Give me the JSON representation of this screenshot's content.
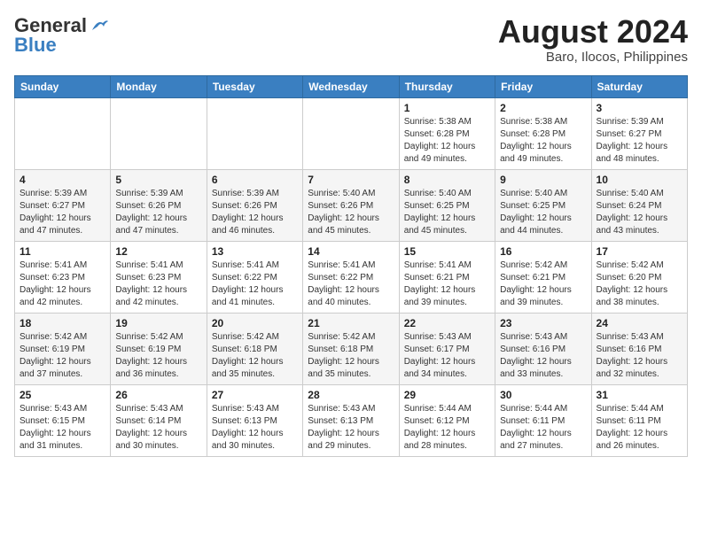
{
  "header": {
    "logo_general": "General",
    "logo_blue": "Blue",
    "month_year": "August 2024",
    "location": "Baro, Ilocos, Philippines"
  },
  "days_of_week": [
    "Sunday",
    "Monday",
    "Tuesday",
    "Wednesday",
    "Thursday",
    "Friday",
    "Saturday"
  ],
  "weeks": [
    [
      {
        "day": "",
        "info": ""
      },
      {
        "day": "",
        "info": ""
      },
      {
        "day": "",
        "info": ""
      },
      {
        "day": "",
        "info": ""
      },
      {
        "day": "1",
        "info": "Sunrise: 5:38 AM\nSunset: 6:28 PM\nDaylight: 12 hours\nand 49 minutes."
      },
      {
        "day": "2",
        "info": "Sunrise: 5:38 AM\nSunset: 6:28 PM\nDaylight: 12 hours\nand 49 minutes."
      },
      {
        "day": "3",
        "info": "Sunrise: 5:39 AM\nSunset: 6:27 PM\nDaylight: 12 hours\nand 48 minutes."
      }
    ],
    [
      {
        "day": "4",
        "info": "Sunrise: 5:39 AM\nSunset: 6:27 PM\nDaylight: 12 hours\nand 47 minutes."
      },
      {
        "day": "5",
        "info": "Sunrise: 5:39 AM\nSunset: 6:26 PM\nDaylight: 12 hours\nand 47 minutes."
      },
      {
        "day": "6",
        "info": "Sunrise: 5:39 AM\nSunset: 6:26 PM\nDaylight: 12 hours\nand 46 minutes."
      },
      {
        "day": "7",
        "info": "Sunrise: 5:40 AM\nSunset: 6:26 PM\nDaylight: 12 hours\nand 45 minutes."
      },
      {
        "day": "8",
        "info": "Sunrise: 5:40 AM\nSunset: 6:25 PM\nDaylight: 12 hours\nand 45 minutes."
      },
      {
        "day": "9",
        "info": "Sunrise: 5:40 AM\nSunset: 6:25 PM\nDaylight: 12 hours\nand 44 minutes."
      },
      {
        "day": "10",
        "info": "Sunrise: 5:40 AM\nSunset: 6:24 PM\nDaylight: 12 hours\nand 43 minutes."
      }
    ],
    [
      {
        "day": "11",
        "info": "Sunrise: 5:41 AM\nSunset: 6:23 PM\nDaylight: 12 hours\nand 42 minutes."
      },
      {
        "day": "12",
        "info": "Sunrise: 5:41 AM\nSunset: 6:23 PM\nDaylight: 12 hours\nand 42 minutes."
      },
      {
        "day": "13",
        "info": "Sunrise: 5:41 AM\nSunset: 6:22 PM\nDaylight: 12 hours\nand 41 minutes."
      },
      {
        "day": "14",
        "info": "Sunrise: 5:41 AM\nSunset: 6:22 PM\nDaylight: 12 hours\nand 40 minutes."
      },
      {
        "day": "15",
        "info": "Sunrise: 5:41 AM\nSunset: 6:21 PM\nDaylight: 12 hours\nand 39 minutes."
      },
      {
        "day": "16",
        "info": "Sunrise: 5:42 AM\nSunset: 6:21 PM\nDaylight: 12 hours\nand 39 minutes."
      },
      {
        "day": "17",
        "info": "Sunrise: 5:42 AM\nSunset: 6:20 PM\nDaylight: 12 hours\nand 38 minutes."
      }
    ],
    [
      {
        "day": "18",
        "info": "Sunrise: 5:42 AM\nSunset: 6:19 PM\nDaylight: 12 hours\nand 37 minutes."
      },
      {
        "day": "19",
        "info": "Sunrise: 5:42 AM\nSunset: 6:19 PM\nDaylight: 12 hours\nand 36 minutes."
      },
      {
        "day": "20",
        "info": "Sunrise: 5:42 AM\nSunset: 6:18 PM\nDaylight: 12 hours\nand 35 minutes."
      },
      {
        "day": "21",
        "info": "Sunrise: 5:42 AM\nSunset: 6:18 PM\nDaylight: 12 hours\nand 35 minutes."
      },
      {
        "day": "22",
        "info": "Sunrise: 5:43 AM\nSunset: 6:17 PM\nDaylight: 12 hours\nand 34 minutes."
      },
      {
        "day": "23",
        "info": "Sunrise: 5:43 AM\nSunset: 6:16 PM\nDaylight: 12 hours\nand 33 minutes."
      },
      {
        "day": "24",
        "info": "Sunrise: 5:43 AM\nSunset: 6:16 PM\nDaylight: 12 hours\nand 32 minutes."
      }
    ],
    [
      {
        "day": "25",
        "info": "Sunrise: 5:43 AM\nSunset: 6:15 PM\nDaylight: 12 hours\nand 31 minutes."
      },
      {
        "day": "26",
        "info": "Sunrise: 5:43 AM\nSunset: 6:14 PM\nDaylight: 12 hours\nand 30 minutes."
      },
      {
        "day": "27",
        "info": "Sunrise: 5:43 AM\nSunset: 6:13 PM\nDaylight: 12 hours\nand 30 minutes."
      },
      {
        "day": "28",
        "info": "Sunrise: 5:43 AM\nSunset: 6:13 PM\nDaylight: 12 hours\nand 29 minutes."
      },
      {
        "day": "29",
        "info": "Sunrise: 5:44 AM\nSunset: 6:12 PM\nDaylight: 12 hours\nand 28 minutes."
      },
      {
        "day": "30",
        "info": "Sunrise: 5:44 AM\nSunset: 6:11 PM\nDaylight: 12 hours\nand 27 minutes."
      },
      {
        "day": "31",
        "info": "Sunrise: 5:44 AM\nSunset: 6:11 PM\nDaylight: 12 hours\nand 26 minutes."
      }
    ]
  ]
}
